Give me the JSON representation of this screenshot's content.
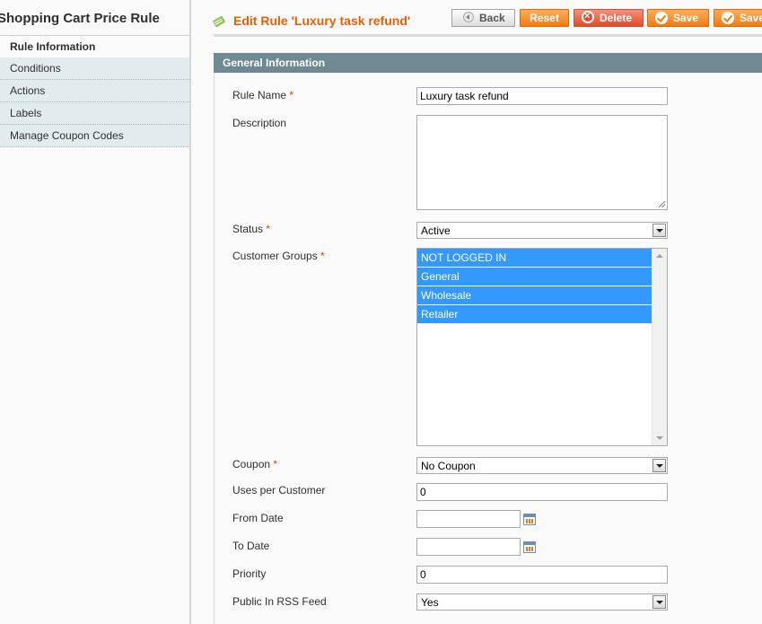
{
  "sidebar": {
    "title": "Shopping Cart Price Rule",
    "tabs": [
      {
        "label": "Rule Information",
        "active": true
      },
      {
        "label": "Conditions"
      },
      {
        "label": "Actions"
      },
      {
        "label": "Labels"
      },
      {
        "label": "Manage Coupon Codes"
      }
    ]
  },
  "header": {
    "title": "Edit Rule 'Luxury task refund'",
    "buttons": {
      "back": "Back",
      "reset": "Reset",
      "delete": "Delete",
      "save": "Save",
      "save_continue": "Save"
    }
  },
  "section": {
    "title": "General Information"
  },
  "form": {
    "rule_name": {
      "label": "Rule Name",
      "value": "Luxury task refund",
      "required": "*"
    },
    "description": {
      "label": "Description",
      "value": ""
    },
    "status": {
      "label": "Status",
      "value": "Active",
      "required": "*"
    },
    "customer_groups": {
      "label": "Customer Groups",
      "required": "*",
      "options": [
        "NOT LOGGED IN",
        "General",
        "Wholesale",
        "Retailer"
      ]
    },
    "coupon": {
      "label": "Coupon",
      "value": "No Coupon",
      "required": "*"
    },
    "uses_per_customer": {
      "label": "Uses per Customer",
      "value": "0"
    },
    "from_date": {
      "label": "From Date",
      "value": ""
    },
    "to_date": {
      "label": "To Date",
      "value": ""
    },
    "priority": {
      "label": "Priority",
      "value": "0"
    },
    "rss": {
      "label": "Public In RSS Feed",
      "value": "Yes"
    }
  },
  "colors": {
    "accent": "#eb5e00",
    "section_header": "#6f8992",
    "selection": "#3399ff"
  },
  "icons": [
    "edit-rule-icon",
    "back-arrow-icon",
    "delete-icon",
    "save-check-icon",
    "calendar-icon",
    "dropdown-arrow-icon"
  ]
}
